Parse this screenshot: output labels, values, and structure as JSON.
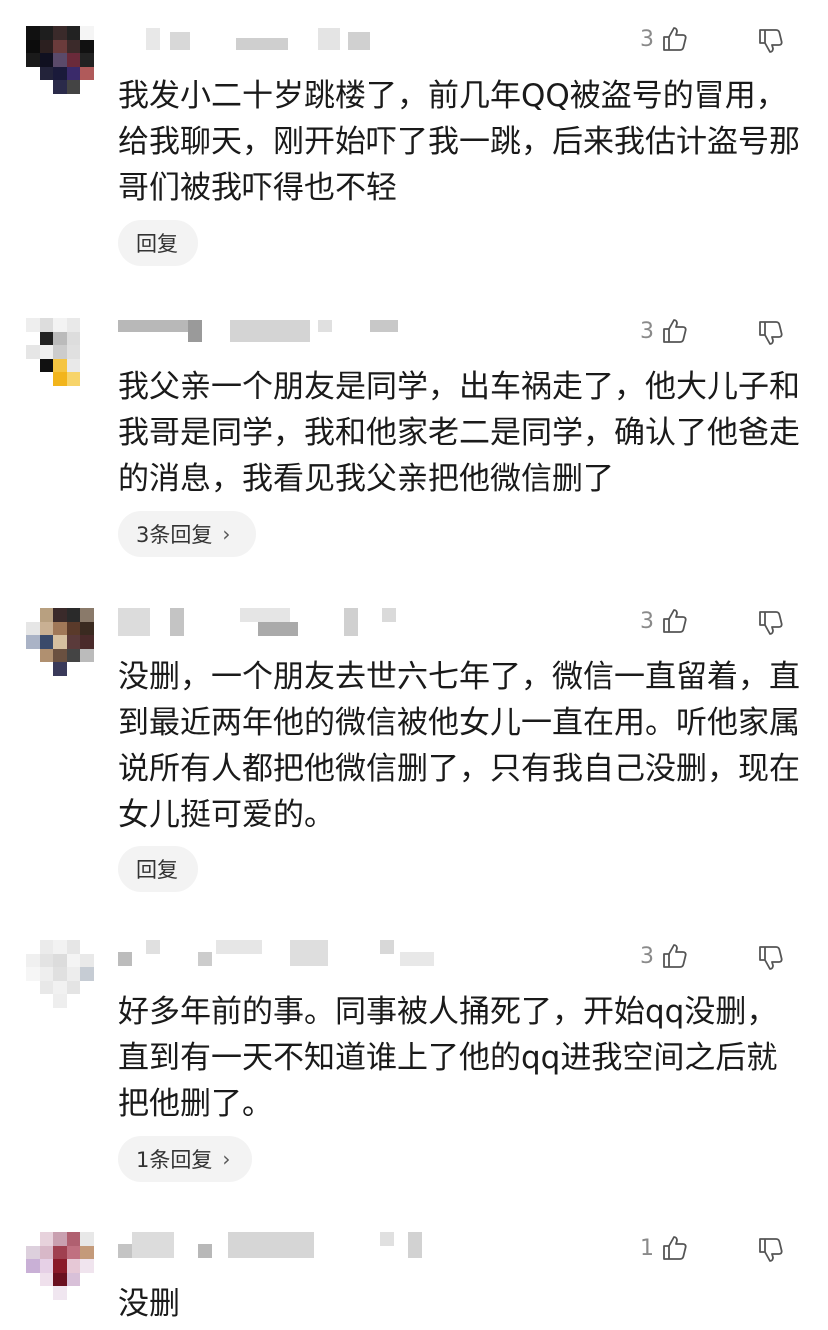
{
  "comments": [
    {
      "likes": "3",
      "text": "我发小二十岁跳楼了，前几年QQ被盗号的冒用，给我聊天，刚开始吓了我一跳，后来我估计盗号那哥们被我吓得也不轻",
      "reply_label": "回复"
    },
    {
      "likes": "3",
      "text": "我父亲一个朋友是同学，出车祸走了，他大儿子和我哥是同学，我和他家老二是同学，确认了他爸走的消息，我看见我父亲把他微信删了",
      "reply_label": "3条回复"
    },
    {
      "likes": "3",
      "text": "没删，一个朋友去世六七年了，微信一直留着，直到最近两年他的微信被他女儿一直在用。听他家属说所有人都把他微信删了，只有我自己没删，现在女儿挺可爱的。",
      "reply_label": "回复"
    },
    {
      "likes": "3",
      "text": "好多年前的事。同事被人捅死了，开始qq没删，直到有一天不知道谁上了他的qq进我空间之后就把他删了。",
      "reply_label": "1条回复"
    },
    {
      "likes": "1",
      "text": "没删",
      "reply_label": ""
    }
  ],
  "icons": {
    "like": "thumbs-up-icon",
    "dislike": "thumbs-down-icon",
    "chevron": "chevron-right-icon"
  },
  "colors": {
    "text": "#1a1a1a",
    "meta": "#8a8a8a",
    "reply_bg": "#f3f3f3"
  }
}
